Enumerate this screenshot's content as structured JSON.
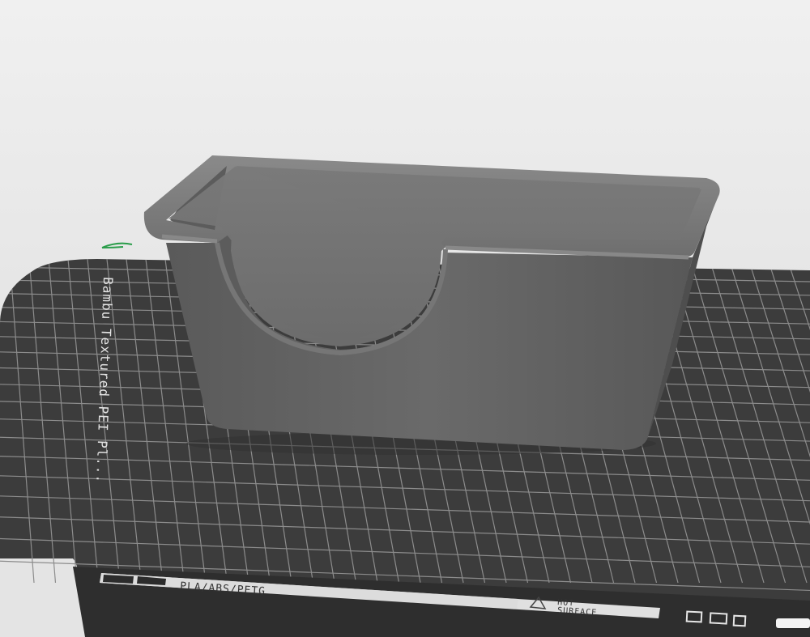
{
  "viewport": {
    "background_color": "#e8e8e8"
  },
  "build_plate": {
    "color": "#3d3d3d",
    "grid_color": "#8a8a8a",
    "side_label": "Bambu Textured PEI Pl...",
    "bottom_strip": {
      "material_text": "PLA/ABS/PETG",
      "warning_line1": "HOT",
      "warning_line2": "SURFACE",
      "warning_icon": "warning-triangle-icon"
    },
    "edge_icons": [
      "plate-icon",
      "screen-icon",
      "print-icon"
    ]
  },
  "model": {
    "name": "",
    "color": "#6b6b6b",
    "shape": "open-top box with semicircular cutout"
  },
  "axis_indicator": {
    "icon": "axis-arrow-icon",
    "color": "#2a9d4a"
  }
}
